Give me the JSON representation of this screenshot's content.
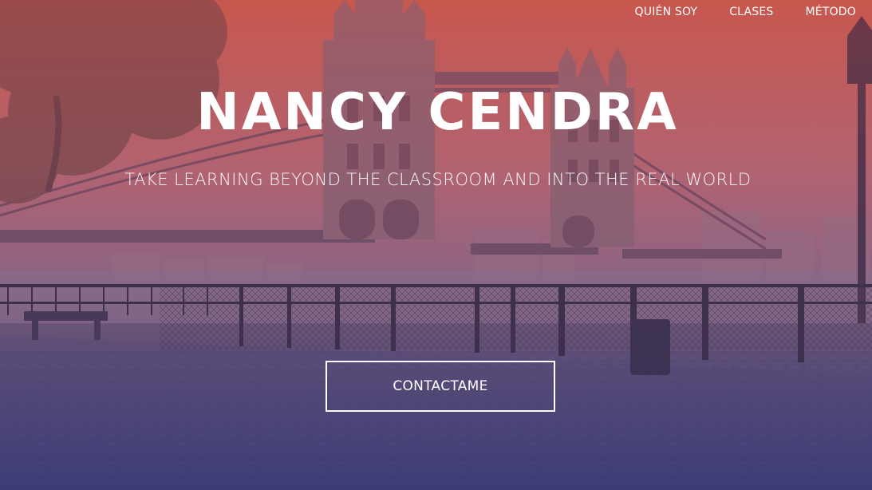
{
  "nav": {
    "items": [
      {
        "label": "QUIÉN SOY"
      },
      {
        "label": "CLASES"
      },
      {
        "label": "MÉTODO"
      }
    ]
  },
  "hero": {
    "title": "NANCY CENDRA",
    "subtitle": "TAKE LEARNING BEYOND THE CLASSROOM AND INTO THE REAL WORLD",
    "cta_label": "CONTACTAME"
  },
  "colors": {
    "overlay_top": "#c8605a",
    "overlay_bottom": "#34357a",
    "text": "#ffffff"
  }
}
